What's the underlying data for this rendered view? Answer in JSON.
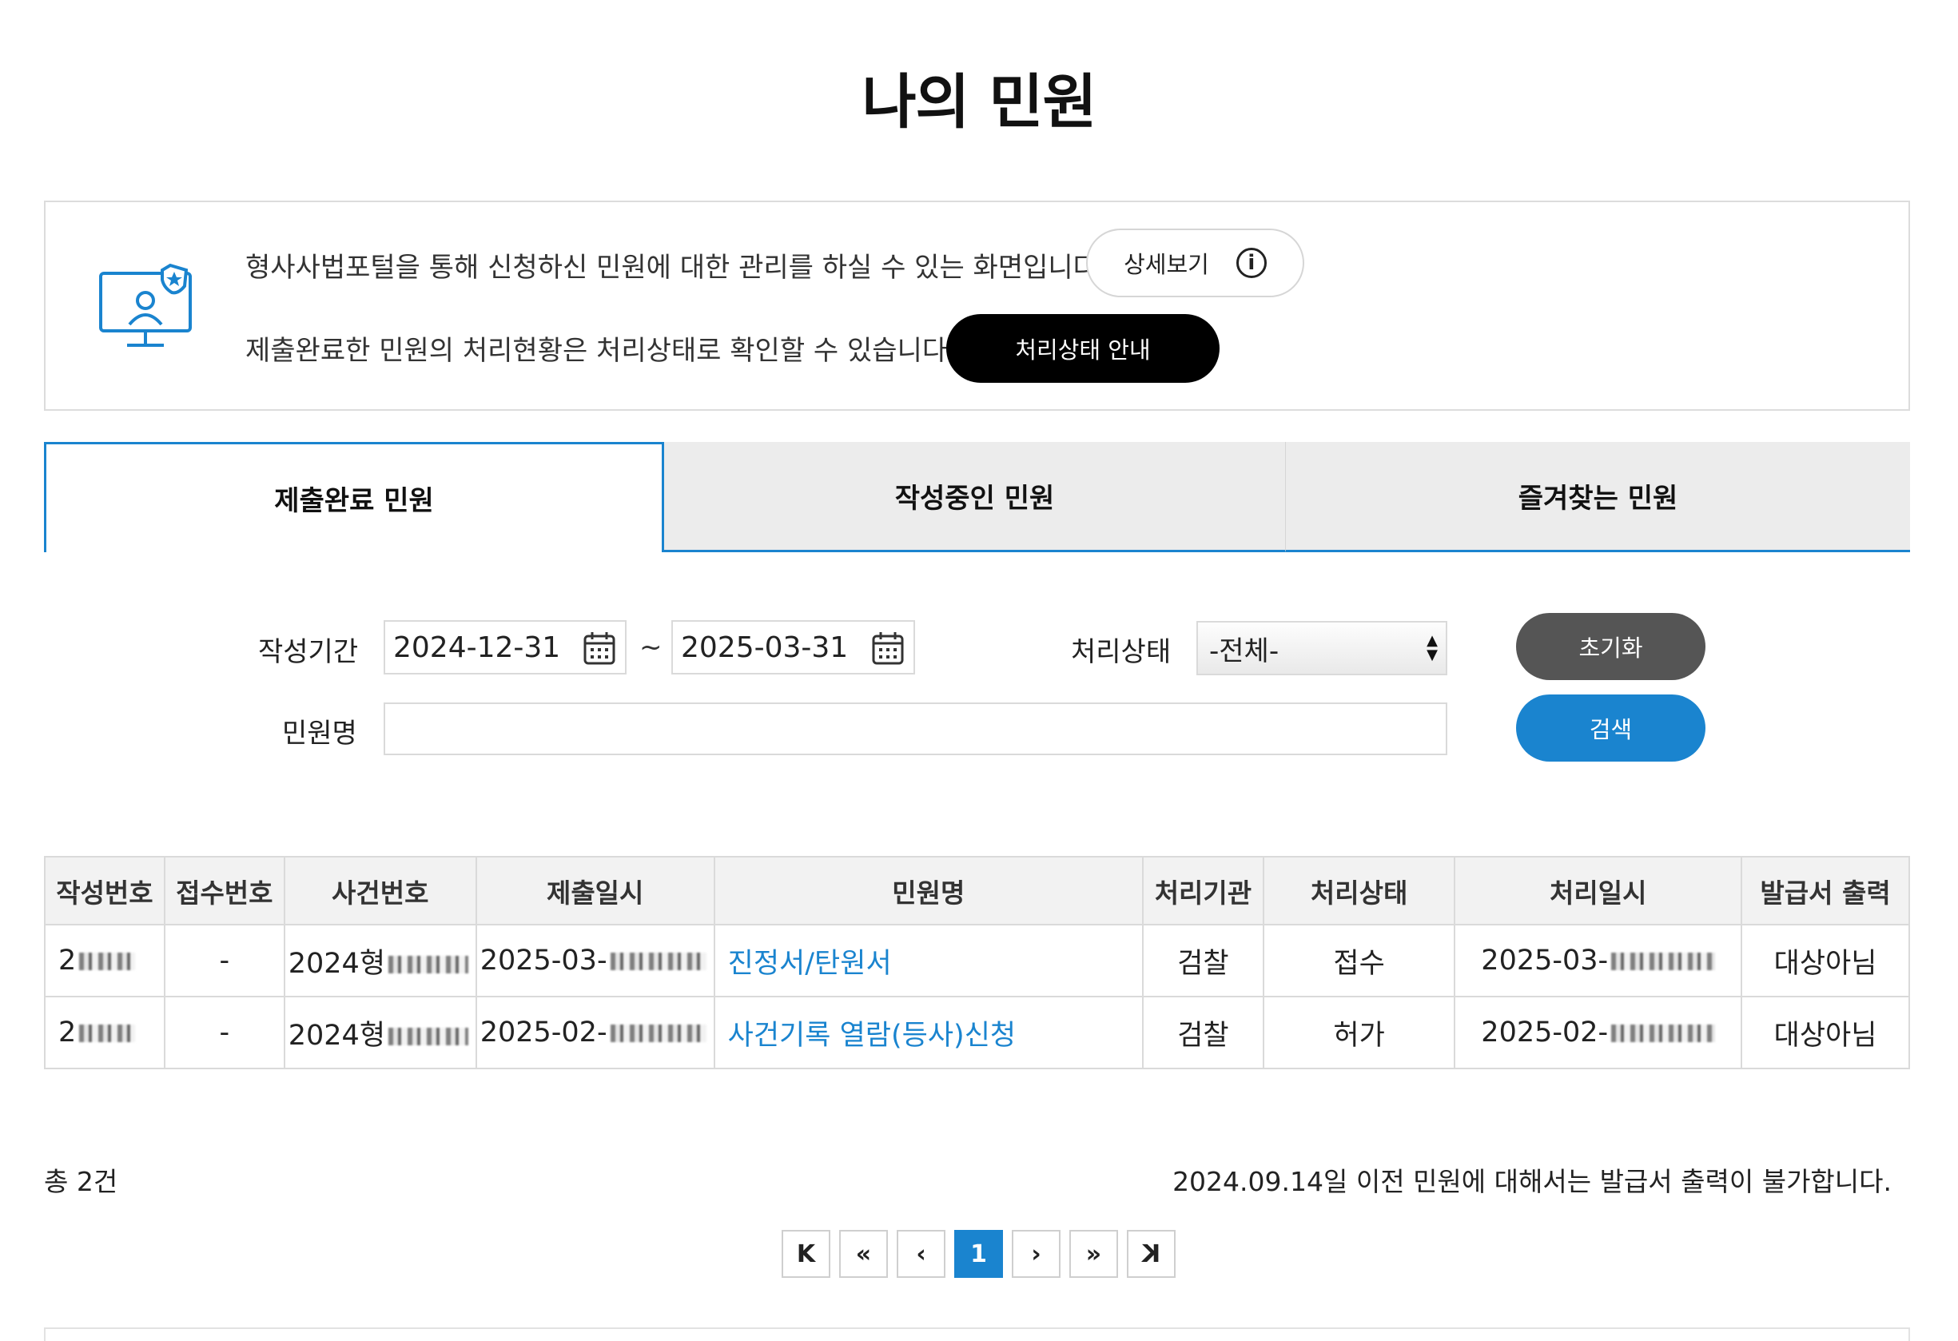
{
  "page": {
    "title": "나의 민원"
  },
  "info": {
    "line1": "형사사법포털을 통해 신청하신 민원에 대한 관리를 하실 수 있는 화면입니다.",
    "line2": "제출완료한 민원의 처리현황은 처리상태로 확인할 수 있습니다.",
    "detail_button": "상세보기",
    "status_button": "처리상태 안내"
  },
  "tabs": [
    {
      "label": "제출완료 민원",
      "active": true
    },
    {
      "label": "작성중인 민원",
      "active": false
    },
    {
      "label": "즐겨찾는 민원",
      "active": false
    }
  ],
  "search": {
    "period_label": "작성기간",
    "date_from": "2024-12-31",
    "date_separator": "~",
    "date_to": "2025-03-31",
    "status_label": "처리상태",
    "status_value": "-전체-",
    "name_label": "민원명",
    "name_value": "",
    "reset_button": "초기화",
    "search_button": "검색"
  },
  "table": {
    "headers": [
      "작성번호",
      "접수번호",
      "사건번호",
      "제출일시",
      "민원명",
      "처리기관",
      "처리상태",
      "처리일시",
      "발급서 출력"
    ],
    "rows": [
      [
        "2",
        "-",
        "2024형",
        "2025-03-",
        "진정서/탄원서",
        "검찰",
        "접수",
        "2025-03-",
        "대상아님"
      ],
      [
        "2",
        "-",
        "2024형",
        "2025-02-",
        "사건기록 열람(등사)신청",
        "검찰",
        "허가",
        "2025-02-",
        "대상아님"
      ]
    ]
  },
  "summary": {
    "total": "총 2건",
    "notice": "2024.09.14일 이전 민원에 대해서는 발급서 출력이 불가합니다."
  },
  "pagination": {
    "first": "K",
    "prev_block": "«",
    "prev": "‹",
    "current": "1",
    "next": "›",
    "next_block": "»",
    "last": "K"
  },
  "colors": {
    "accent": "#1a84cf",
    "dark_button": "#000000",
    "reset_button": "#555555"
  }
}
